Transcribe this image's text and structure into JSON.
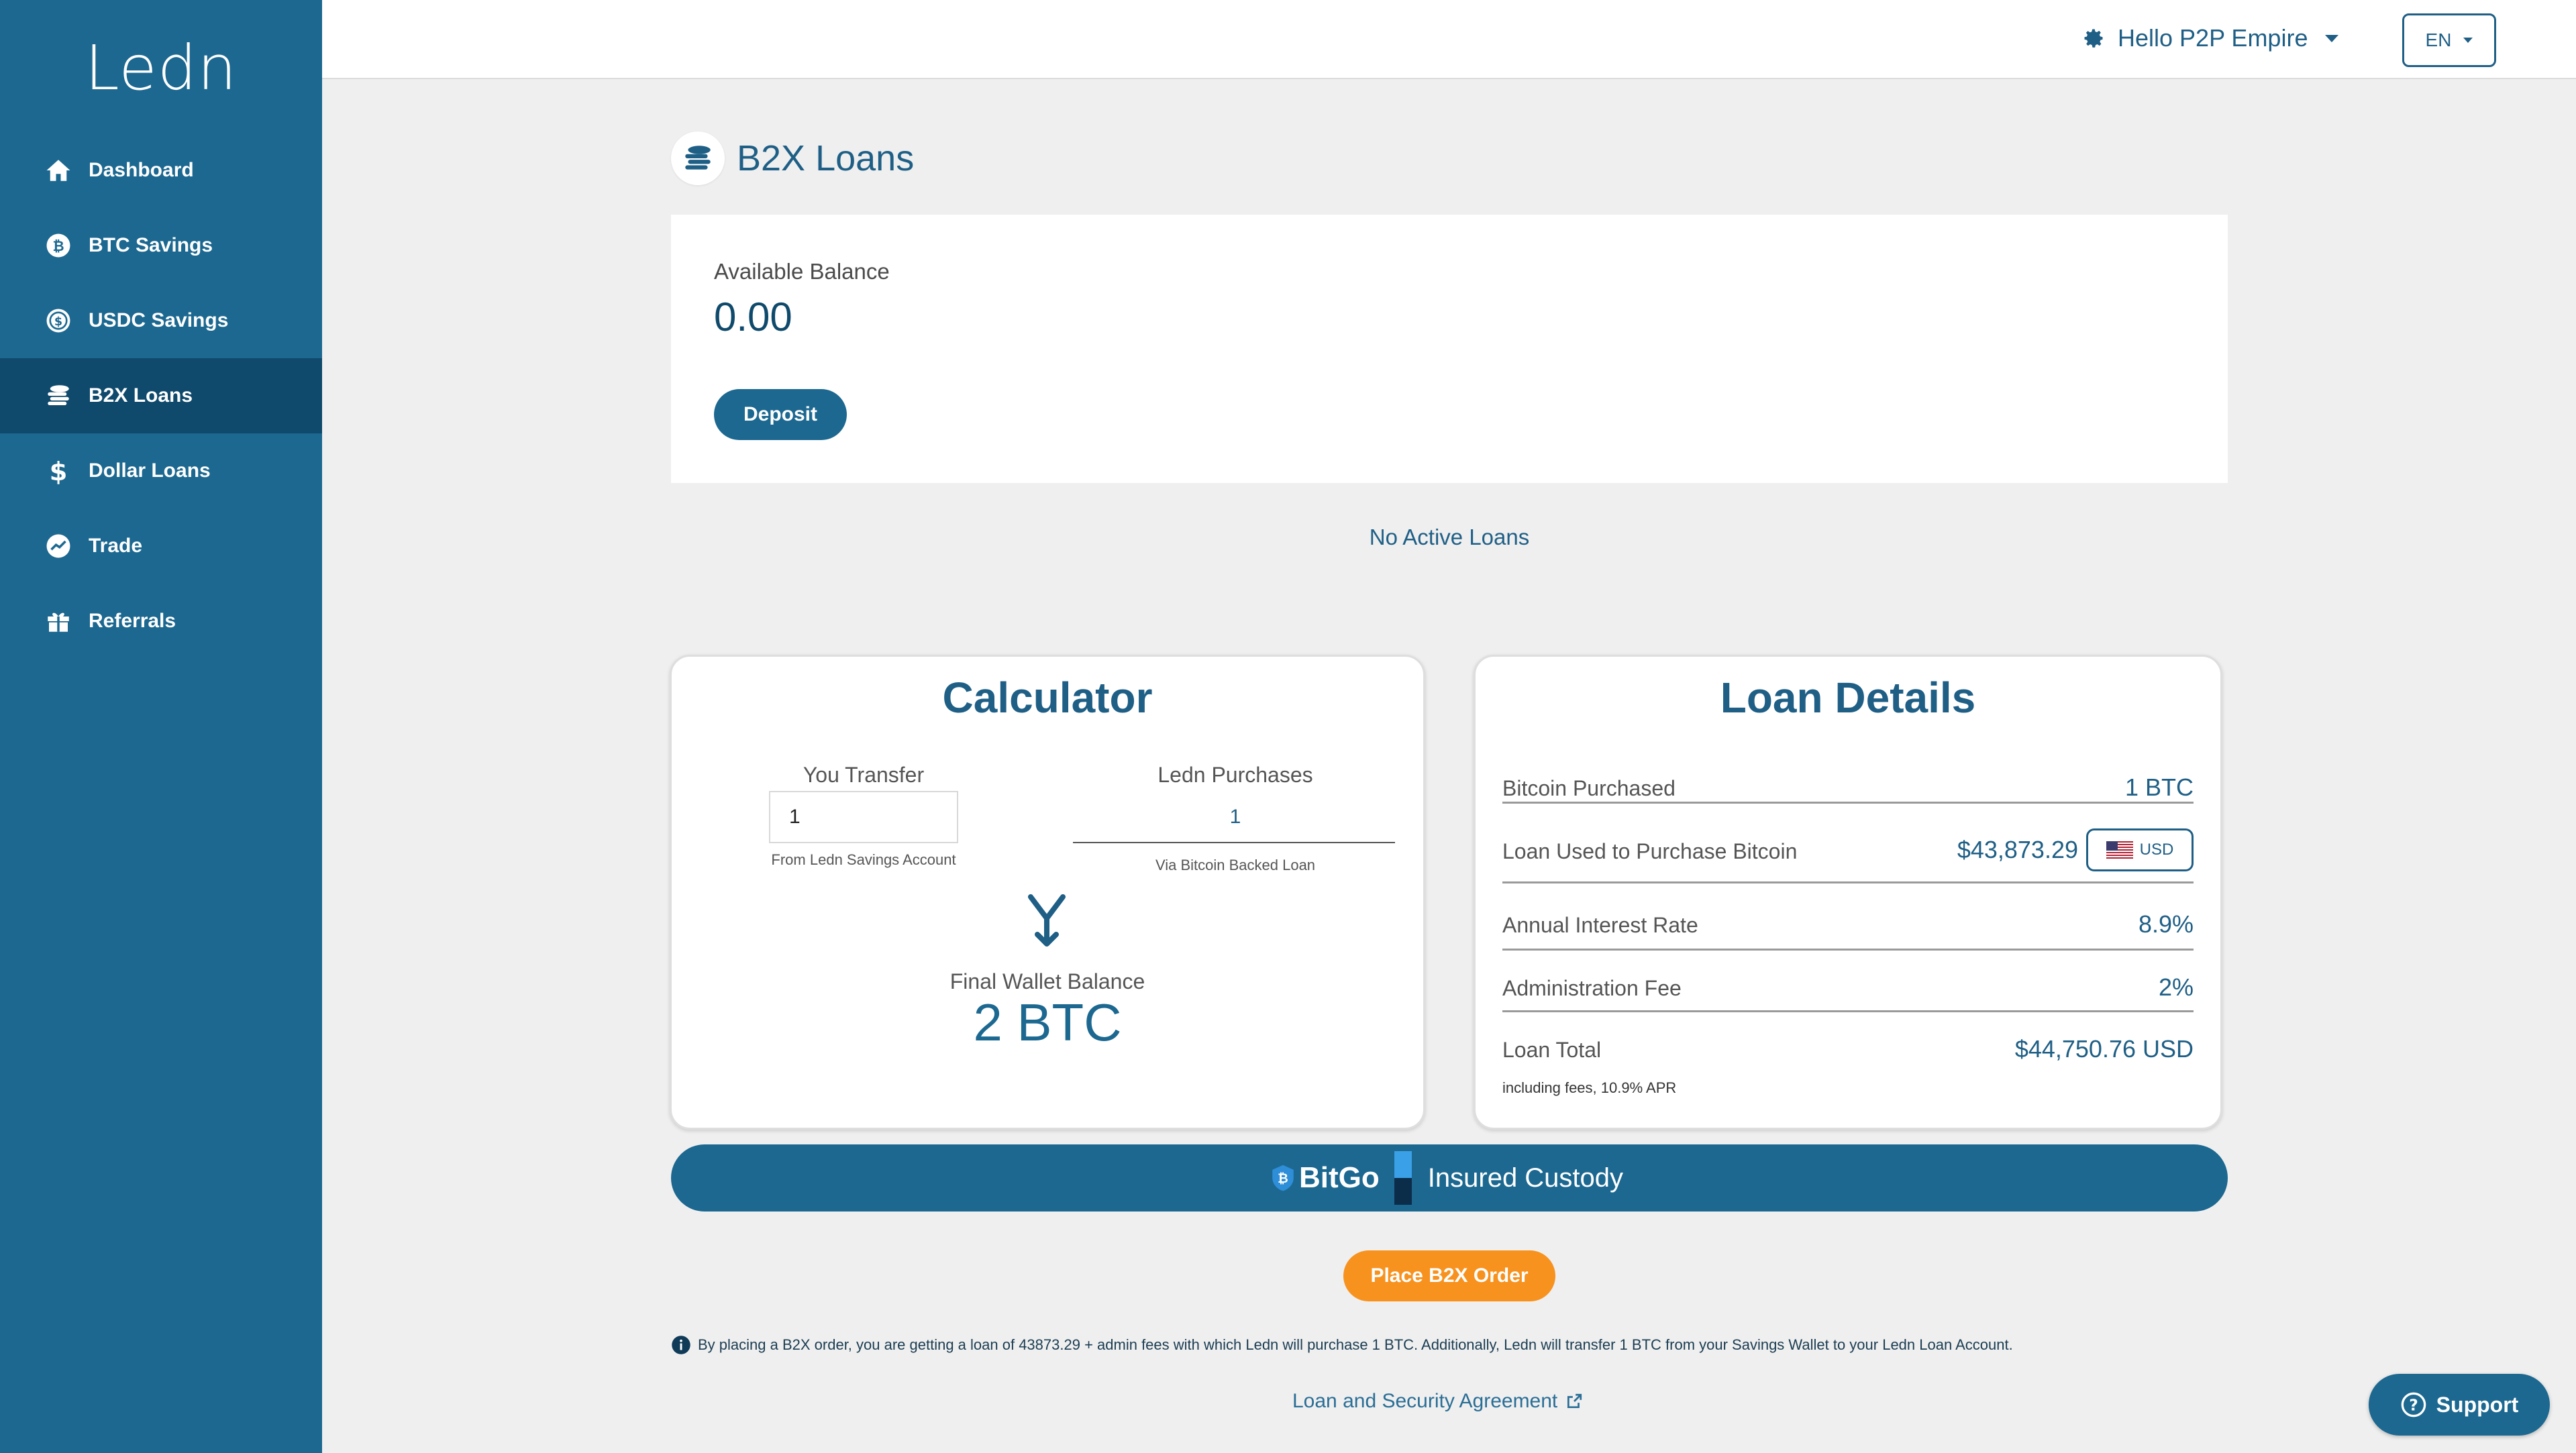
{
  "sidebar": {
    "logo": "Ledn",
    "items": [
      {
        "label": "Dashboard",
        "icon": "home-icon"
      },
      {
        "label": "BTC Savings",
        "icon": "bitcoin-icon"
      },
      {
        "label": "USDC Savings",
        "icon": "usdc-icon"
      },
      {
        "label": "B2X Loans",
        "icon": "coins-icon",
        "active": true
      },
      {
        "label": "Dollar Loans",
        "icon": "dollar-icon"
      },
      {
        "label": "Trade",
        "icon": "trend-icon"
      },
      {
        "label": "Referrals",
        "icon": "gift-icon"
      }
    ]
  },
  "header": {
    "greeting": "Hello P2P Empire",
    "language": "EN"
  },
  "page": {
    "title": "B2X Loans"
  },
  "balance": {
    "label": "Available Balance",
    "value": "0.00",
    "deposit_label": "Deposit"
  },
  "loans_status": "No Active Loans",
  "calculator": {
    "title": "Calculator",
    "transfer_label": "You Transfer",
    "transfer_value": "1",
    "transfer_note": "From Ledn Savings Account",
    "purchases_label": "Ledn Purchases",
    "purchases_value": "1",
    "purchases_note": "Via Bitcoin Backed Loan",
    "final_label": "Final Wallet Balance",
    "final_value": "2 BTC"
  },
  "loan_details": {
    "title": "Loan Details",
    "rows": [
      {
        "label": "Bitcoin Purchased",
        "value": "1 BTC"
      },
      {
        "label": "Loan Used to Purchase Bitcoin",
        "value": "$43,873.29",
        "currency": "USD"
      },
      {
        "label": "Annual Interest Rate",
        "value": "8.9%"
      },
      {
        "label": "Administration Fee",
        "value": "2%"
      },
      {
        "label": "Loan Total",
        "value": "$44,750.76 USD",
        "sub": "including fees, 10.9% APR"
      }
    ]
  },
  "custody": {
    "brand": "BitGo",
    "text": "Insured Custody"
  },
  "order_button": "Place B2X Order",
  "disclaimer": "By placing a B2X order, you are getting a loan of 43873.29 + admin fees with which Ledn will purchase 1 BTC. Additionally, Ledn will transfer 1 BTC from your Savings Wallet to your Ledn Loan Account.",
  "agreement_link": "Loan and Security Agreement",
  "support_label": "Support",
  "colors": {
    "sidebar": "#1c6890",
    "sidebar_active": "#0f4a6c",
    "accent_orange": "#f7921e",
    "text_primary": "#1f5f86"
  }
}
